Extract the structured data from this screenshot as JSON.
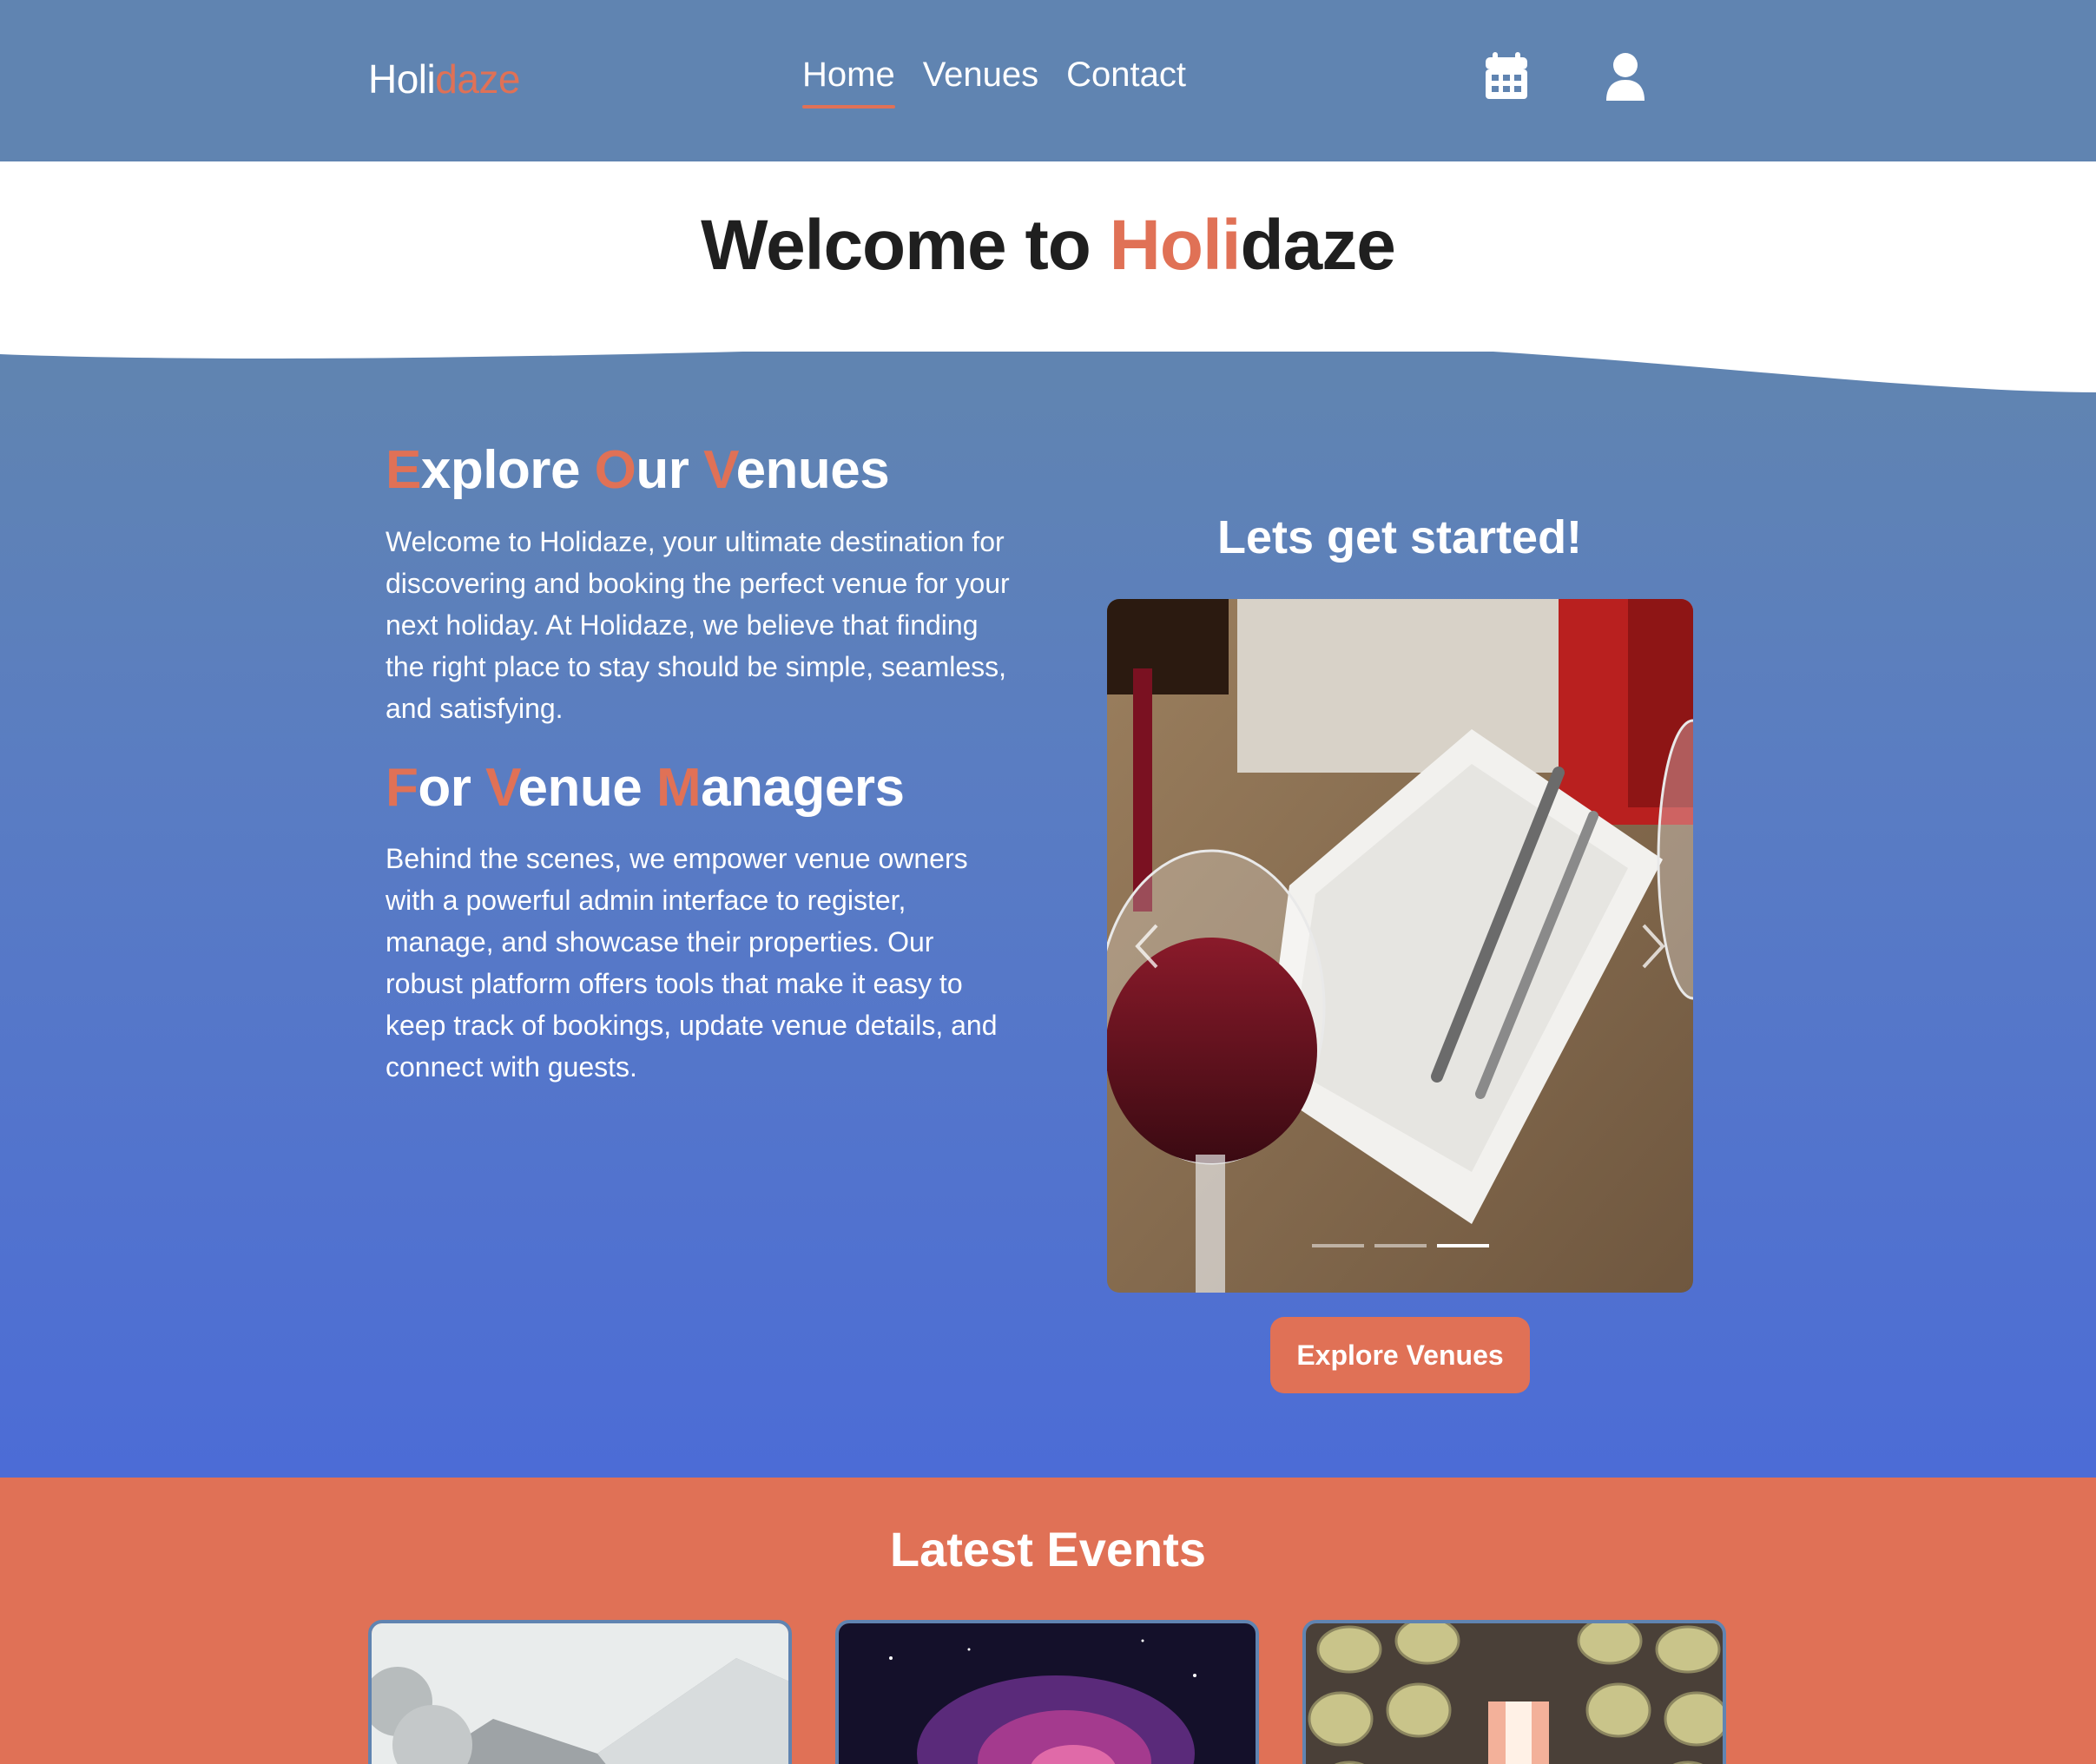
{
  "header": {
    "logo_main": "Holi",
    "logo_accent": "daze",
    "nav": [
      "Home",
      "Venues",
      "Contact"
    ],
    "active_nav": "Home",
    "icons": [
      "calendar-icon",
      "user-icon"
    ]
  },
  "welcome": {
    "prefix": "Welcome to ",
    "accent": "Holi",
    "suffix": "daze"
  },
  "explore": {
    "heading_parts": [
      {
        "cap": "E",
        "rest": "xplore "
      },
      {
        "cap": "O",
        "rest": "ur "
      },
      {
        "cap": "V",
        "rest": "enues"
      }
    ],
    "text": "Welcome to Holidaze, your ultimate destination for discovering and booking the perfect venue for your next holiday. At Holidaze, we believe that finding the right place to stay should be simple, seamless, and satisfying."
  },
  "managers": {
    "heading_parts": [
      {
        "cap": "F",
        "rest": "or "
      },
      {
        "cap": "V",
        "rest": "enue "
      },
      {
        "cap": "M",
        "rest": "anagers"
      }
    ],
    "text": "Behind the scenes, we empower venue owners with a powerful admin interface to register, manage, and showcase their properties. Our robust platform offers tools that make it easy to keep track of bookings, update venue details, and connect with guests."
  },
  "carousel": {
    "title": "Lets get started!",
    "slide_count": 3,
    "active_slide": 3
  },
  "cta": {
    "label": "Explore Venues"
  },
  "events": {
    "title": "Latest Events"
  },
  "colors": {
    "primary": "#6084b1",
    "accent": "#e07156",
    "gradient_end": "#4c6cd6"
  }
}
